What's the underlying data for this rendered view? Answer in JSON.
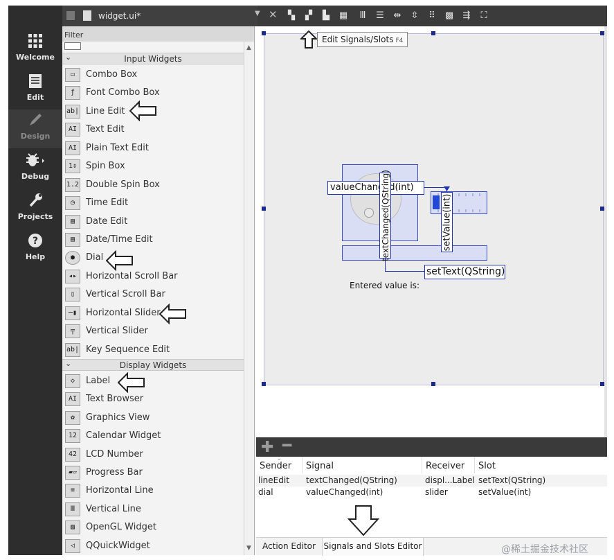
{
  "modes": [
    {
      "label": "Welcome",
      "icon": "grid-icon"
    },
    {
      "label": "Edit",
      "icon": "document-icon"
    },
    {
      "label": "Design",
      "icon": "pencil-icon"
    },
    {
      "label": "Debug",
      "icon": "bug-icon"
    },
    {
      "label": "Projects",
      "icon": "wrench-icon"
    },
    {
      "label": "Help",
      "icon": "help-icon"
    }
  ],
  "toolbar": {
    "file_name": "widget.ui*",
    "tooltip_text": "Edit Signals/Slots",
    "tooltip_shortcut": "F4"
  },
  "widget_box": {
    "filter_label": "Filter",
    "categories": [
      "Input Widgets",
      "Display Widgets"
    ],
    "input_items": [
      {
        "label": "Combo Box",
        "icon": "combo-box-icon"
      },
      {
        "label": "Font Combo Box",
        "icon": "font-combo-box-icon"
      },
      {
        "label": "Line Edit",
        "icon": "line-edit-icon"
      },
      {
        "label": "Text Edit",
        "icon": "text-edit-icon"
      },
      {
        "label": "Plain Text Edit",
        "icon": "plain-text-edit-icon"
      },
      {
        "label": "Spin Box",
        "icon": "spin-box-icon"
      },
      {
        "label": "Double Spin Box",
        "icon": "double-spin-box-icon"
      },
      {
        "label": "Time Edit",
        "icon": "clock-icon"
      },
      {
        "label": "Date Edit",
        "icon": "calendar-icon"
      },
      {
        "label": "Date/Time Edit",
        "icon": "calendar-clock-icon"
      },
      {
        "label": "Dial",
        "icon": "dial-icon"
      },
      {
        "label": "Horizontal Scroll Bar",
        "icon": "horizontal-scroll-bar-icon"
      },
      {
        "label": "Vertical Scroll Bar",
        "icon": "vertical-scroll-bar-icon"
      },
      {
        "label": "Horizontal Slider",
        "icon": "horizontal-slider-icon"
      },
      {
        "label": "Vertical Slider",
        "icon": "vertical-slider-icon"
      },
      {
        "label": "Key Sequence Edit",
        "icon": "key-sequence-edit-icon"
      }
    ],
    "display_items": [
      {
        "label": "Label",
        "icon": "label-tag-icon"
      },
      {
        "label": "Text Browser",
        "icon": "text-browser-icon"
      },
      {
        "label": "Graphics View",
        "icon": "graphics-view-icon"
      },
      {
        "label": "Calendar Widget",
        "icon": "calendar-widget-icon"
      },
      {
        "label": "LCD Number",
        "icon": "lcd-number-icon"
      },
      {
        "label": "Progress Bar",
        "icon": "progress-bar-icon"
      },
      {
        "label": "Horizontal Line",
        "icon": "horizontal-line-icon"
      },
      {
        "label": "Vertical Line",
        "icon": "vertical-line-icon"
      },
      {
        "label": "OpenGL Widget",
        "icon": "opengl-widget-icon"
      },
      {
        "label": "QQuickWidget",
        "icon": "qquickwidget-icon"
      }
    ]
  },
  "canvas": {
    "signal_value_changed": "valueChanged(int)",
    "signal_text_changed": "textChanged(QString)",
    "slot_set_value": "setValue(int)",
    "slot_set_text": "setText(QString)",
    "entered_label": "Entered value is:"
  },
  "signal_slot_editor": {
    "headers": [
      "Sender",
      "Signal",
      "Receiver",
      "Slot"
    ],
    "rows": [
      [
        "lineEdit",
        "textChanged(QString)",
        "displ...Label",
        "setText(QString)"
      ],
      [
        "dial",
        "valueChanged(int)",
        "slider",
        "setValue(int)"
      ]
    ],
    "tabs": [
      "Action Editor",
      "Signals and Slots Editor"
    ],
    "active_tab": "Signals and Slots Editor"
  },
  "watermark": "@稀土掘金技术社区"
}
